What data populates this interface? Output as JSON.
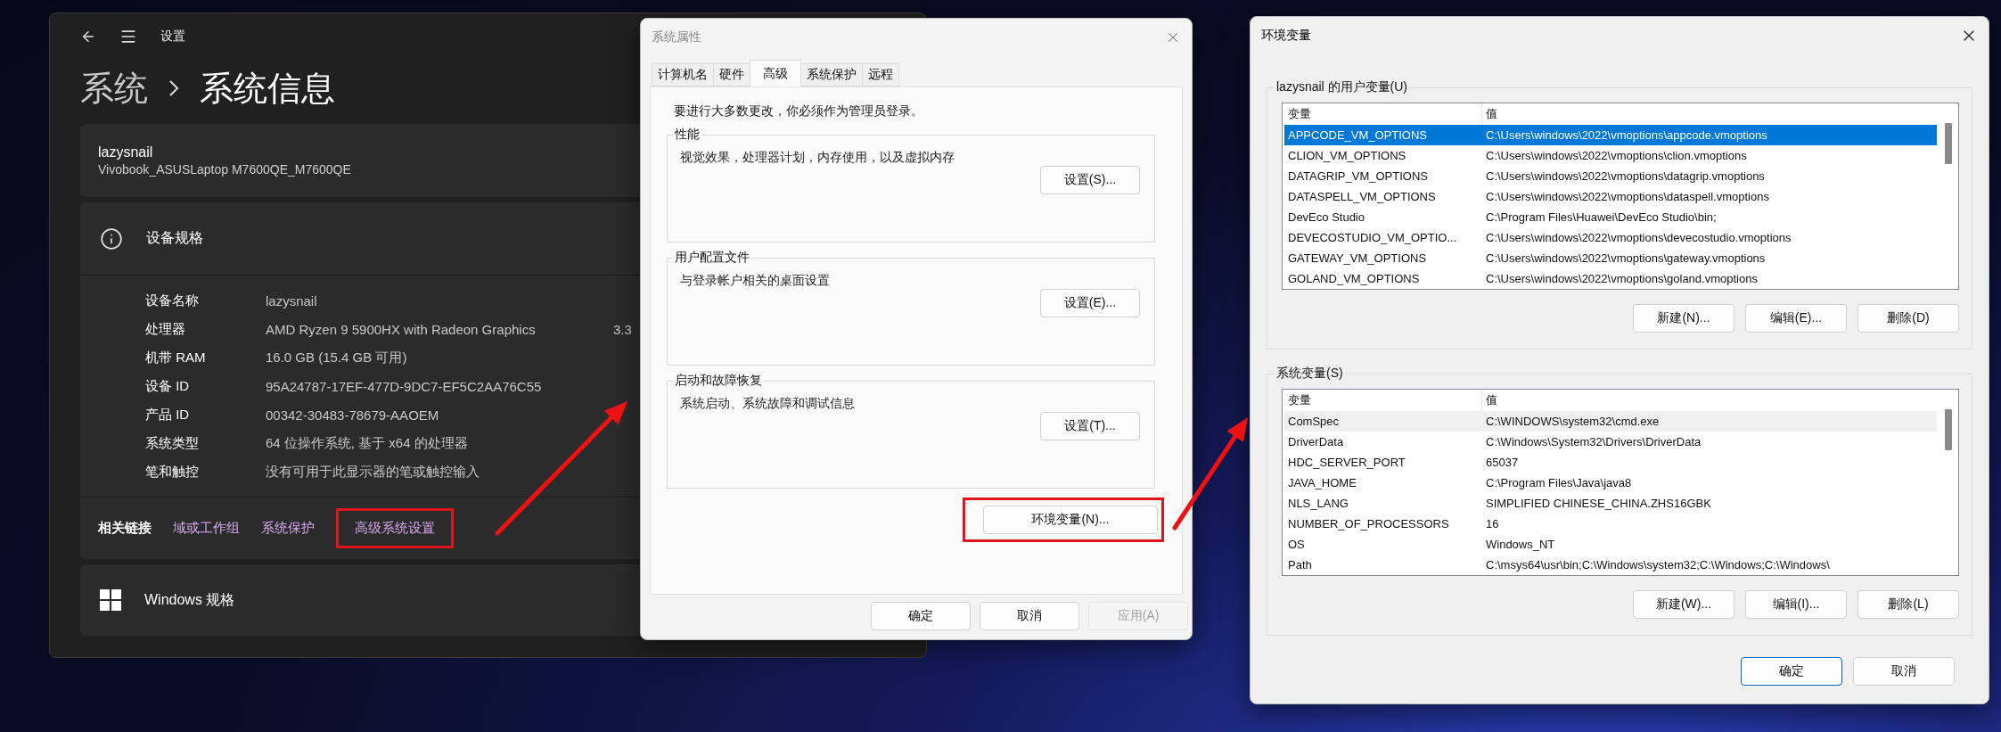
{
  "settings": {
    "title": "设置",
    "breadcrumb": [
      "系统",
      "系统信息"
    ],
    "device": {
      "name": "lazysnail",
      "model": "Vivobook_ASUSLaptop M7600QE_M7600QE"
    },
    "specs": {
      "title": "设备规格",
      "rows": [
        {
          "label": "设备名称",
          "value": "lazysnail"
        },
        {
          "label": "处理器",
          "value": "AMD Ryzen 9 5900HX with Radeon Graphics",
          "extra": "3.3"
        },
        {
          "label": "机带 RAM",
          "value": "16.0 GB (15.4 GB 可用)"
        },
        {
          "label": "设备 ID",
          "value": "95A24787-17EF-477D-9DC7-EF5C2AA76C55"
        },
        {
          "label": "产品 ID",
          "value": "00342-30483-78679-AAOEM"
        },
        {
          "label": "系统类型",
          "value": "64 位操作系统, 基于 x64 的处理器"
        },
        {
          "label": "笔和触控",
          "value": "没有可用于此显示器的笔或触控输入"
        }
      ]
    },
    "related": {
      "label": "相关链接",
      "links": [
        {
          "text": "域或工作组",
          "highlighted": false
        },
        {
          "text": "系统保护",
          "highlighted": false
        },
        {
          "text": "高级系统设置",
          "highlighted": true
        }
      ]
    },
    "windows_spec": {
      "title": "Windows 规格"
    }
  },
  "system_properties": {
    "title": "系统属性",
    "tabs": [
      {
        "label": "计算机名",
        "selected": false
      },
      {
        "label": "硬件",
        "selected": false
      },
      {
        "label": "高级",
        "selected": true
      },
      {
        "label": "系统保护",
        "selected": false
      },
      {
        "label": "远程",
        "selected": false
      }
    ],
    "notice": "要进行大多数更改，你必须作为管理员登录。",
    "groups": [
      {
        "title": "性能",
        "description": "视觉效果，处理器计划，内存使用，以及虚拟内存",
        "button": "设置(S)..."
      },
      {
        "title": "用户配置文件",
        "description": "与登录帐户相关的桌面设置",
        "button": "设置(E)..."
      },
      {
        "title": "启动和故障恢复",
        "description": "系统启动、系统故障和调试信息",
        "button": "设置(T)..."
      }
    ],
    "env_button": {
      "label": "环境变量(N)...",
      "highlighted": true
    },
    "buttons": [
      {
        "label": "确定",
        "disabled": false
      },
      {
        "label": "取消",
        "disabled": false
      },
      {
        "label": "应用(A)",
        "disabled": true
      }
    ]
  },
  "environment_variables": {
    "title": "环境变量",
    "lists": [
      {
        "title": "lazysnail 的用户变量(U)",
        "focused": true,
        "columns": [
          "变量",
          "值"
        ],
        "rows": [
          {
            "name": "APPCODE_VM_OPTIONS",
            "value": "C:\\Users\\windows\\2022\\vmoptions\\appcode.vmoptions",
            "selected": true
          },
          {
            "name": "CLION_VM_OPTIONS",
            "value": "C:\\Users\\windows\\2022\\vmoptions\\clion.vmoptions",
            "selected": false
          },
          {
            "name": "DATAGRIP_VM_OPTIONS",
            "value": "C:\\Users\\windows\\2022\\vmoptions\\datagrip.vmoptions",
            "selected": false
          },
          {
            "name": "DATASPELL_VM_OPTIONS",
            "value": "C:\\Users\\windows\\2022\\vmoptions\\dataspell.vmoptions",
            "selected": false
          },
          {
            "name": "DevEco Studio",
            "value": "C:\\Program Files\\Huawei\\DevEco Studio\\bin;",
            "selected": false
          },
          {
            "name": "DEVECOSTUDIO_VM_OPTIO...",
            "value": "C:\\Users\\windows\\2022\\vmoptions\\devecostudio.vmoptions",
            "selected": false
          },
          {
            "name": "GATEWAY_VM_OPTIONS",
            "value": "C:\\Users\\windows\\2022\\vmoptions\\gateway.vmoptions",
            "selected": false
          },
          {
            "name": "GOLAND_VM_OPTIONS",
            "value": "C:\\Users\\windows\\2022\\vmoptions\\goland.vmoptions",
            "selected": false
          }
        ],
        "buttons": [
          "新建(N)...",
          "编辑(E)...",
          "删除(D)"
        ]
      },
      {
        "title": "系统变量(S)",
        "focused": false,
        "columns": [
          "变量",
          "值"
        ],
        "rows": [
          {
            "name": "ComSpec",
            "value": "C:\\WINDOWS\\system32\\cmd.exe",
            "selected": true
          },
          {
            "name": "DriverData",
            "value": "C:\\Windows\\System32\\Drivers\\DriverData",
            "selected": false
          },
          {
            "name": "HDC_SERVER_PORT",
            "value": "65037",
            "selected": false
          },
          {
            "name": "JAVA_HOME",
            "value": "C:\\Program Files\\Java\\java8",
            "selected": false
          },
          {
            "name": "NLS_LANG",
            "value": "SIMPLIFIED CHINESE_CHINA.ZHS16GBK",
            "selected": false
          },
          {
            "name": "NUMBER_OF_PROCESSORS",
            "value": "16",
            "selected": false
          },
          {
            "name": "OS",
            "value": "Windows_NT",
            "selected": false
          },
          {
            "name": "Path",
            "value": "C:\\msys64\\usr\\bin;C:\\Windows\\system32;C:\\Windows;C:\\Windows\\",
            "selected": false
          }
        ],
        "buttons": [
          "新建(W)...",
          "编辑(I)...",
          "删除(L)"
        ]
      }
    ],
    "buttons": [
      {
        "label": "确定",
        "default": true
      },
      {
        "label": "取消",
        "default": false
      }
    ]
  }
}
